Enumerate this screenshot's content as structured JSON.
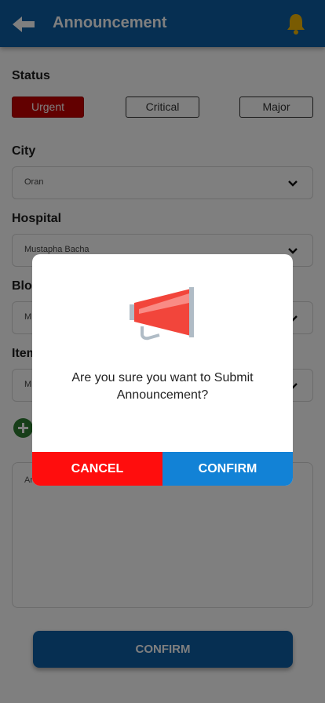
{
  "header": {
    "title": "Announcement",
    "back_icon": "arrow-left-icon",
    "bell_icon": "bell-icon",
    "bell_color": "#f2b705",
    "bg_color": "#0d5fa4"
  },
  "form": {
    "status_label": "Status",
    "status_options": [
      "Urgent",
      "Critical",
      "Major"
    ],
    "status_selected": "Urgent",
    "city_label": "City",
    "city_value": "Oran",
    "hospital_label": "Hospital",
    "hospital_value": "Mustapha Bacha",
    "blood_label_visible": "Bloo",
    "blood_value_visible": "M",
    "item_label_visible": "Item",
    "item_value_visible": "M",
    "textarea_placeholder_visible": "An",
    "confirm_label": "CONFIRM"
  },
  "dialog": {
    "icon": "megaphone-icon",
    "message": "Are you sure you want to Submit Announcement?",
    "cancel_label": "CANCEL",
    "confirm_label": "CONFIRM",
    "cancel_color": "#ff0d0d",
    "confirm_color": "#1282d6"
  }
}
